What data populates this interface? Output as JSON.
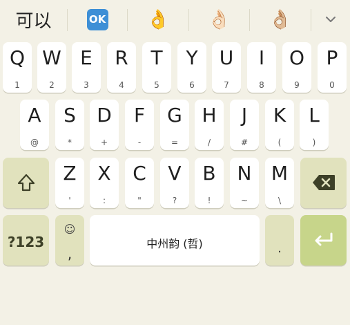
{
  "suggestions": {
    "word": "可以",
    "ok_emoji": "OK",
    "hand_emoji_1": "👌",
    "hand_emoji_2": "👌🏻",
    "hand_emoji_3": "👌🏼",
    "expand_icon": "chevron-down-icon"
  },
  "rows": {
    "row1": [
      {
        "main": "Q",
        "sub": "1"
      },
      {
        "main": "W",
        "sub": "2"
      },
      {
        "main": "E",
        "sub": "3"
      },
      {
        "main": "R",
        "sub": "4"
      },
      {
        "main": "T",
        "sub": "5"
      },
      {
        "main": "Y",
        "sub": "6"
      },
      {
        "main": "U",
        "sub": "7"
      },
      {
        "main": "I",
        "sub": "8"
      },
      {
        "main": "O",
        "sub": "9"
      },
      {
        "main": "P",
        "sub": "0"
      }
    ],
    "row2": [
      {
        "main": "A",
        "sub": "@"
      },
      {
        "main": "S",
        "sub": "*"
      },
      {
        "main": "D",
        "sub": "+"
      },
      {
        "main": "F",
        "sub": "-"
      },
      {
        "main": "G",
        "sub": "="
      },
      {
        "main": "H",
        "sub": "/"
      },
      {
        "main": "J",
        "sub": "#"
      },
      {
        "main": "K",
        "sub": "("
      },
      {
        "main": "L",
        "sub": ")"
      }
    ],
    "row3": [
      {
        "main": "Z",
        "sub": "'"
      },
      {
        "main": "X",
        "sub": ":"
      },
      {
        "main": "C",
        "sub": "\""
      },
      {
        "main": "V",
        "sub": "?"
      },
      {
        "main": "B",
        "sub": "!"
      },
      {
        "main": "N",
        "sub": "~"
      },
      {
        "main": "M",
        "sub": "\\"
      }
    ]
  },
  "bottom": {
    "symbols_label": "?123",
    "emoji_label": "☺",
    "comma_label": ",",
    "space_label": "中州韵 (哲)",
    "period_label": "."
  },
  "icons": {
    "shift": "shift-icon",
    "backspace": "backspace-icon",
    "enter": "enter-icon"
  },
  "colors": {
    "background": "#f3f1e6",
    "key": "#ffffff",
    "function_key": "#e1e2bd",
    "enter_key": "#c7d58a"
  }
}
